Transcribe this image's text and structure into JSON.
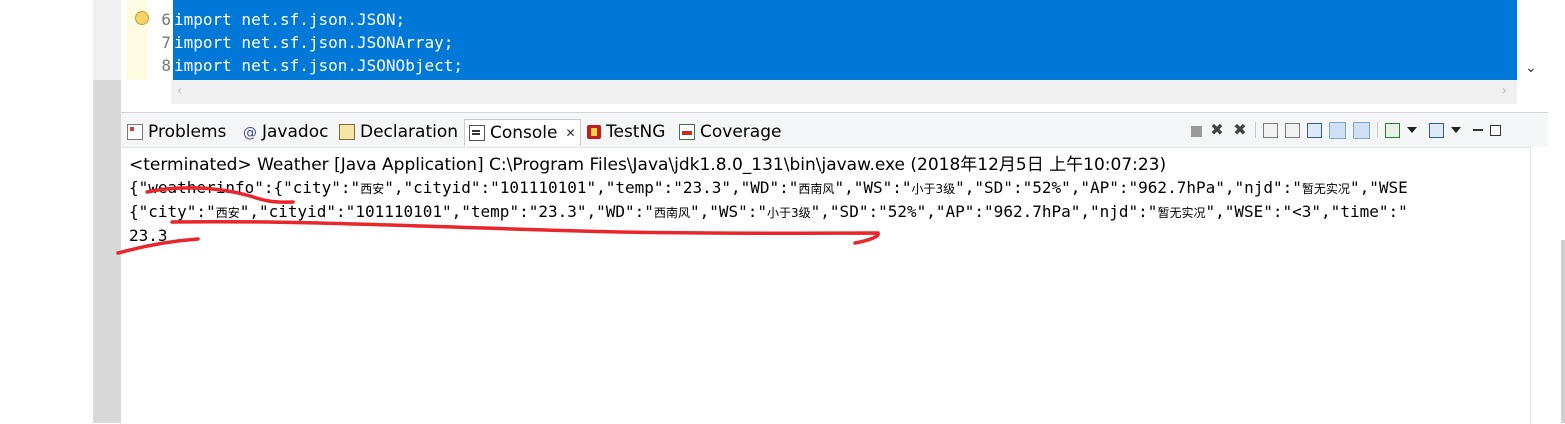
{
  "editor": {
    "line_numbers": [
      "6",
      "7",
      "8"
    ],
    "lines": [
      "import net.sf.json.JSON;",
      "import net.sf.json.JSONArray;",
      "import net.sf.json.JSONObject;"
    ],
    "selection_color": "#0078d7"
  },
  "tabs": [
    {
      "label": "Problems",
      "icon": "problems-icon"
    },
    {
      "label": "Javadoc",
      "icon": "javadoc-icon"
    },
    {
      "label": "Declaration",
      "icon": "declaration-icon"
    },
    {
      "label": "Console",
      "icon": "console-icon",
      "active": true
    },
    {
      "label": "TestNG",
      "icon": "testng-icon"
    },
    {
      "label": "Coverage",
      "icon": "coverage-icon"
    }
  ],
  "console": {
    "status": "<terminated> Weather [Java Application] C:\\Program Files\\Java\\jdk1.8.0_131\\bin\\javaw.exe (2018年12月5日 上午10:07:23)",
    "line1": [
      {
        "t": "{\"weatherinfo\":{\"city\":\""
      },
      {
        "t": "西安",
        "zh": true
      },
      {
        "t": "\",\"cityid\":\"101110101\",\"temp\":\"23.3\",\"WD\":\""
      },
      {
        "t": "西南风",
        "zh": true
      },
      {
        "t": "\",\"WS\":\""
      },
      {
        "t": "小于3级",
        "zh": true
      },
      {
        "t": "\",\"SD\":\"52%\",\"AP\":\"962.7hPa\",\"njd\":\""
      },
      {
        "t": "暂无实况",
        "zh": true
      },
      {
        "t": "\",\"WSE"
      }
    ],
    "line2": [
      {
        "t": "{\"city\":\""
      },
      {
        "t": "西安",
        "zh": true
      },
      {
        "t": "\",\"cityid\":\"101110101\",\"temp\":\"23.3\",\"WD\":\""
      },
      {
        "t": "西南风",
        "zh": true
      },
      {
        "t": "\",\"WS\":\""
      },
      {
        "t": "小于3级",
        "zh": true
      },
      {
        "t": "\",\"SD\":\"52%\",\"AP\":\"962.7hPa\",\"njd\":\""
      },
      {
        "t": "暂无实况",
        "zh": true
      },
      {
        "t": "\",\"WSE\":\"<3\",\"time\":\""
      }
    ],
    "line3": "23.3"
  },
  "toolbar_icons": [
    "terminate-icon",
    "remove-launch-icon",
    "remove-all-terminated-icon",
    "scroll-lock-icon",
    "word-wrap-icon",
    "pin-console-icon",
    "show-when-stdout-icon",
    "show-when-stderr-icon",
    "display-selected-console-icon",
    "open-console-icon",
    "view-menu-icon",
    "minimize-icon",
    "maximize-icon"
  ],
  "annotation_color": "#e8262b"
}
